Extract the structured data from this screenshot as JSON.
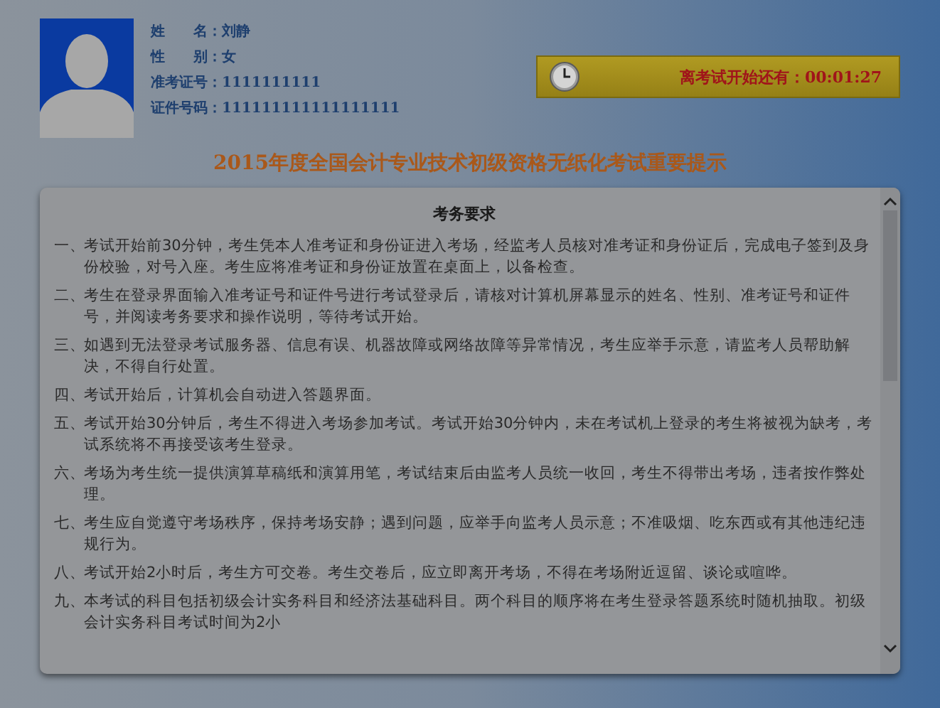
{
  "candidate": {
    "fields": [
      {
        "label": "姓　　名：",
        "value": "刘静"
      },
      {
        "label": "性　　别：",
        "value": "女"
      },
      {
        "label": "准考证号：",
        "value": "1111111111"
      },
      {
        "label": "证件号码：",
        "value": "111111111111111111"
      }
    ]
  },
  "countdown": {
    "label": "离考试开始还有：",
    "time": "00:01:27"
  },
  "title": "2015年度全国会计专业技术初级资格无纸化考试重要提示",
  "notice": {
    "heading": "考务要求",
    "items": [
      {
        "number": "一、",
        "text": "考试开始前30分钟，考生凭本人准考证和身份证进入考场，经监考人员核对准考证和身份证后，完成电子签到及身份校验，对号入座。考生应将准考证和身份证放置在桌面上，以备检查。"
      },
      {
        "number": "二、",
        "text": "考生在登录界面输入准考证号和证件号进行考试登录后，请核对计算机屏幕显示的姓名、性别、准考证号和证件号，并阅读考务要求和操作说明，等待考试开始。"
      },
      {
        "number": "三、",
        "text": "如遇到无法登录考试服务器、信息有误、机器故障或网络故障等异常情况，考生应举手示意，请监考人员帮助解决，不得自行处置。"
      },
      {
        "number": "四、",
        "text": "考试开始后，计算机会自动进入答题界面。"
      },
      {
        "number": "五、",
        "text": "考试开始30分钟后，考生不得进入考场参加考试。考试开始30分钟内，未在考试机上登录的考生将被视为缺考，考试系统将不再接受该考生登录。"
      },
      {
        "number": "六、",
        "text": "考场为考生统一提供演算草稿纸和演算用笔，考试结束后由监考人员统一收回，考生不得带出考场，违者按作弊处理。"
      },
      {
        "number": "七、",
        "text": "考生应自觉遵守考场秩序，保持考场安静；遇到问题，应举手向监考人员示意；不准吸烟、吃东西或有其他违纪违规行为。"
      },
      {
        "number": "八、",
        "text": "考试开始2小时后，考生方可交卷。考生交卷后，应立即离开考场，不得在考场附近逗留、谈论或喧哗。"
      },
      {
        "number": "九、",
        "text": "本考试的科目包括初级会计实务科目和经济法基础科目。两个科目的顺序将在考生登录答题系统时随机抽取。初级会计实务科目考试时间为2小"
      }
    ]
  }
}
